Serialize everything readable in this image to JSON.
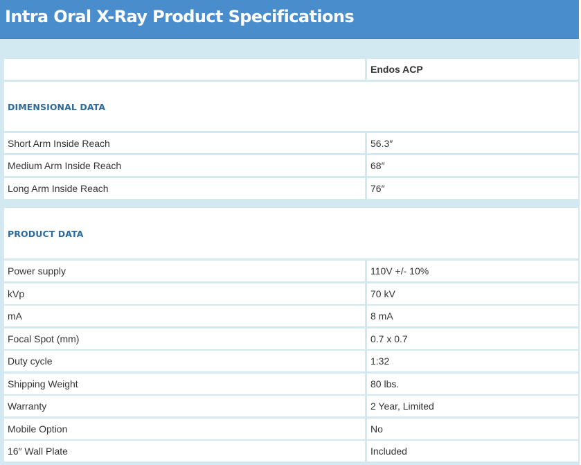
{
  "title": "Intra Oral X-Ray Product Specifications",
  "header_row": {
    "label": "",
    "model": "Endos ACP"
  },
  "sections": [
    {
      "heading": "DIMENSIONAL DATA",
      "rows": [
        {
          "label": "Short Arm Inside Reach",
          "value": "56.3″"
        },
        {
          "label": "Medium Arm Inside Reach",
          "value": "68″"
        },
        {
          "label": "Long Arm Inside Reach",
          "value": "76″"
        }
      ]
    },
    {
      "heading": "PRODUCT DATA",
      "rows": [
        {
          "label": "Power supply",
          "value": "110V +/- 10%"
        },
        {
          "label": "kVp",
          "value": "70 kV"
        },
        {
          "label": "mA",
          "value": "8 mA"
        },
        {
          "label": "Focal Spot (mm)",
          "value": "0.7 x 0.7"
        },
        {
          "label": "Duty cycle",
          "value": "1:32"
        },
        {
          "label": "Shipping Weight",
          "value": "80 lbs."
        },
        {
          "label": "Warranty",
          "value": "2 Year, Limited"
        },
        {
          "label": "Mobile Option",
          "value": "No"
        },
        {
          "label": "16″ Wall Plate",
          "value": "Included"
        }
      ]
    }
  ]
}
